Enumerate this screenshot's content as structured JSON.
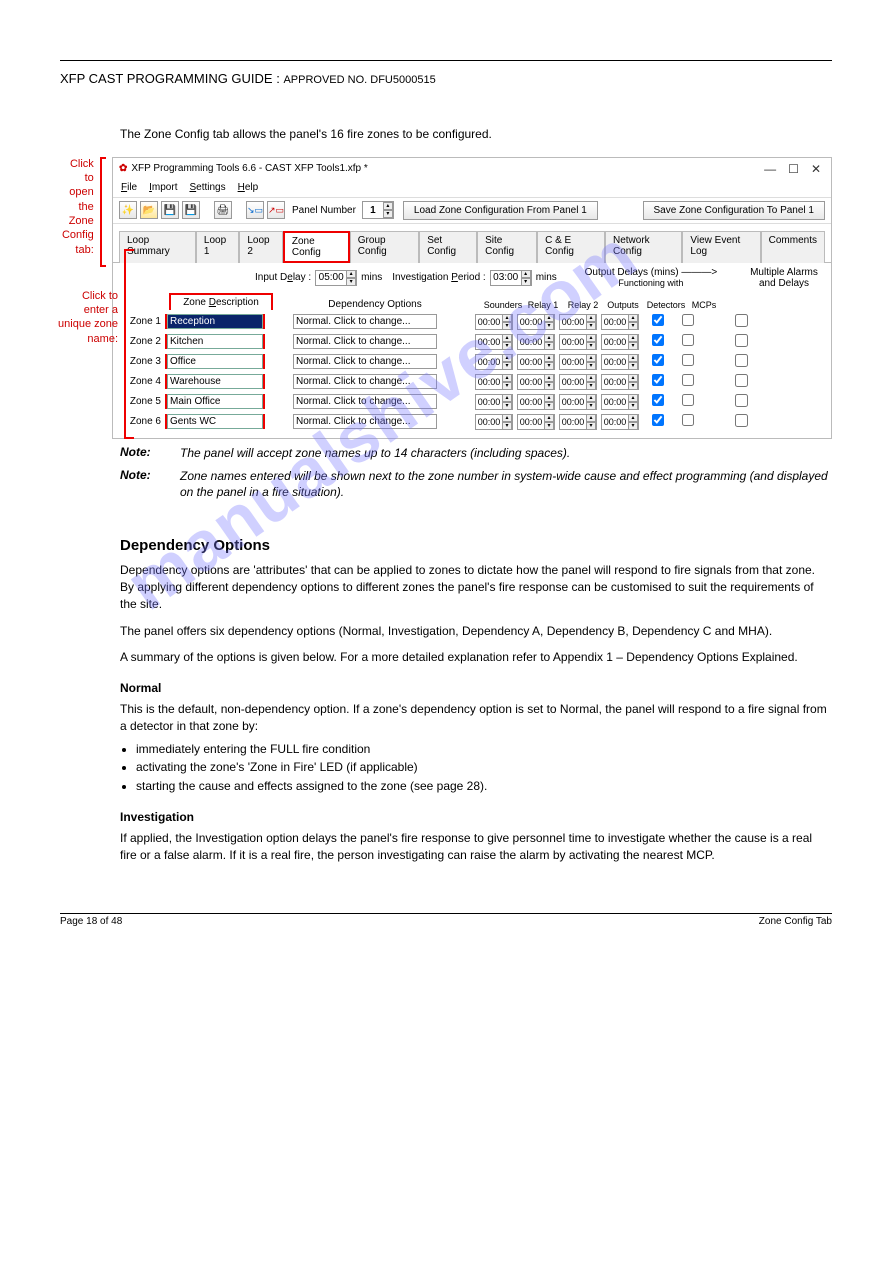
{
  "header": {
    "title_prefix": "XFP CAST PROGRAMMING GUIDE",
    "title_sep": " : ",
    "title_suffix": "APPROVED NO. DFU5000515"
  },
  "intro": "The Zone Config tab allows the panel's 16 fire zones to be configured.",
  "annot1": "Click to open the Zone Config tab:",
  "annot2": "Click to enter a unique zone name:",
  "win": {
    "title": "XFP Programming Tools 6.6 - CAST XFP Tools1.xfp *",
    "menus": {
      "file": "File",
      "import": "Import",
      "settings": "Settings",
      "help": "Help"
    },
    "toolbar": {
      "panel_number_label": "Panel  Number",
      "panel_number_value": "1",
      "load_btn": "Load Zone Configuration From Panel 1",
      "save_btn": "Save Zone Configuration To Panel 1"
    },
    "tabs": [
      "Loop Summary",
      "Loop 1",
      "Loop 2",
      "Zone Config",
      "Group Config",
      "Set Config",
      "Site Config",
      "C & E Config",
      "Network Config",
      "View Event Log",
      "Comments"
    ],
    "active_tab_index": 3,
    "cfg": {
      "input_delay_label": "Input Delay :",
      "input_delay_value": "05:00",
      "mins": "mins",
      "inv_label": "Investigation Period :",
      "inv_value": "03:00",
      "output_delays": "Output Delays  (mins)",
      "arrow": "———>",
      "functioning": "Functioning with",
      "multi": "Multiple Alarms and Delays"
    },
    "headers": {
      "zone_desc": "Zone Description",
      "dep": "Dependency Options",
      "sounders": "Sounders",
      "relay1": "Relay 1",
      "relay2": "Relay 2",
      "outputs": "Outputs",
      "detectors": "Detectors",
      "mcps": "MCPs"
    },
    "zones": [
      {
        "label": "Zone 1",
        "desc": "Reception",
        "selected": true,
        "dep": "Normal. Click to change...",
        "d": "00:00",
        "det": true,
        "mcp": false,
        "multi": false
      },
      {
        "label": "Zone 2",
        "desc": "Kitchen",
        "selected": false,
        "dep": "Normal. Click to change...",
        "d": "00:00",
        "det": true,
        "mcp": false,
        "multi": false
      },
      {
        "label": "Zone 3",
        "desc": "Office",
        "selected": false,
        "dep": "Normal. Click to change...",
        "d": "00:00",
        "det": true,
        "mcp": false,
        "multi": false
      },
      {
        "label": "Zone 4",
        "desc": "Warehouse",
        "selected": false,
        "dep": "Normal. Click to change...",
        "d": "00:00",
        "det": true,
        "mcp": false,
        "multi": false
      },
      {
        "label": "Zone 5",
        "desc": "Main Office",
        "selected": false,
        "dep": "Normal. Click to change...",
        "d": "00:00",
        "det": true,
        "mcp": false,
        "multi": false
      },
      {
        "label": "Zone 6",
        "desc": "Gents WC",
        "selected": false,
        "dep": "Normal. Click to change...",
        "d": "00:00",
        "det": true,
        "mcp": false,
        "multi": false
      }
    ]
  },
  "notes": {
    "label": "Note:",
    "n1": "The panel will accept zone names up to 14 characters (including spaces).",
    "n2": "Zone names entered will be shown next to the zone number in system-wide cause and effect programming (and displayed on the panel in a fire situation)."
  },
  "sections": {
    "dep_h": "Dependency Options",
    "dep_p1": "Dependency options are 'attributes' that can be applied to zones to dictate how the panel will respond to fire signals from that zone. By applying different dependency options to different zones the panel's fire response can be customised to suit the requirements of the site.",
    "dep_p2": "The panel offers six dependency options (Normal, Investigation, Dependency A, Dependency B, Dependency C and MHA).",
    "dep_p3": "A summary of the options is given below. For a more detailed explanation refer to Appendix 1 – Dependency Options Explained.",
    "normal_h": "Normal",
    "normal_p": "This is the default, non-dependency option. If a zone's dependency option is set to Normal, the panel will respond to a fire signal from a detector in that zone by:",
    "bullets": [
      "immediately entering the FULL fire condition",
      "activating the zone's 'Zone in Fire' LED (if applicable)",
      "starting the cause and effects assigned to the zone (see page 28)."
    ],
    "inv_h": "Investigation",
    "inv_p": "If applied, the Investigation option delays the panel's fire response to give personnel time to investigate whether the cause is a real fire or a false alarm. If it is a real fire, the person investigating can raise the alarm by activating the nearest MCP."
  },
  "watermark": "manualshive.com",
  "footer": {
    "left": "Page 18 of 48",
    "right": "Zone Config Tab"
  }
}
